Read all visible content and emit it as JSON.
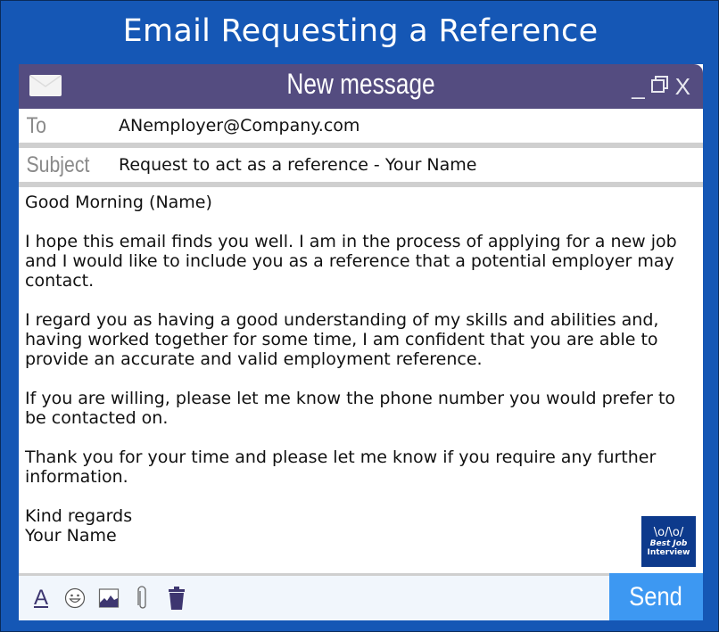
{
  "banner": {
    "title": "Email Requesting a Reference"
  },
  "window": {
    "title": "New message",
    "controls": {
      "minimize": "_",
      "restore": "❐",
      "close": "X"
    }
  },
  "fields": {
    "to": {
      "label": "To",
      "value": "ANemployer@Company.com"
    },
    "subject": {
      "label": "Subject",
      "value": "Request to act as a reference - Your Name"
    }
  },
  "body": {
    "greeting": "Good Morning (Name)",
    "paragraphs": [
      "I hope this email finds you well. I am in the process of applying for a new job and I would like to include you as a reference that a potential employer may contact.",
      "I regard you as having a good understanding of my skills and abilities and, having worked together for some time, I am confident that you are able to provide an accurate and valid employment reference.",
      "If you are willing, please let me know the phone number you would prefer to be contacted on.",
      "Thank you for your time and please let me know if you require any further information."
    ],
    "closing": "Kind regards",
    "signature": "Your Name"
  },
  "logo": {
    "line1": "Best Job",
    "line2": "Interview",
    "people": "\\o/\\o/"
  },
  "toolbar": {
    "format_glyph": "A",
    "icons": [
      "format-text-icon",
      "emoji-icon",
      "image-icon",
      "attachment-icon",
      "trash-icon"
    ],
    "send_label": "Send"
  },
  "colors": {
    "background": "#1557b5",
    "titlebar": "#544c80",
    "send": "#3d98f2",
    "icon": "#3d3670"
  }
}
